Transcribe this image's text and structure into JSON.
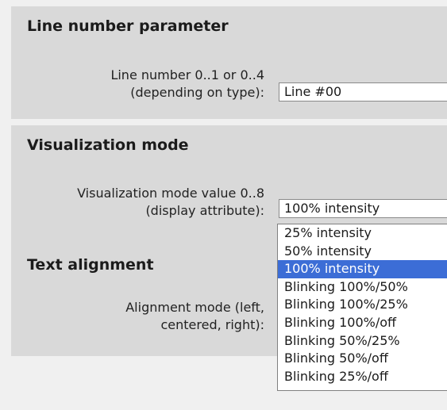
{
  "line_number": {
    "heading": "Line number parameter",
    "label_line1": "Line number 0..1 or 0..4",
    "label_line2": "(depending on type):",
    "value": "Line #00"
  },
  "visualization": {
    "heading": "Visualization mode",
    "label_line1": "Visualization mode value 0..8",
    "label_line2": "(display attribute):",
    "selected": "100% intensity",
    "options": [
      "25% intensity",
      "50% intensity",
      "100% intensity",
      "Blinking 100%/50%",
      "Blinking 100%/25%",
      "Blinking 100%/off",
      "Blinking 50%/25%",
      "Blinking 50%/off",
      "Blinking 25%/off"
    ]
  },
  "alignment": {
    "heading": "Text alignment",
    "label_line1": "Alignment mode (left,",
    "label_line2": "centered, right):"
  }
}
